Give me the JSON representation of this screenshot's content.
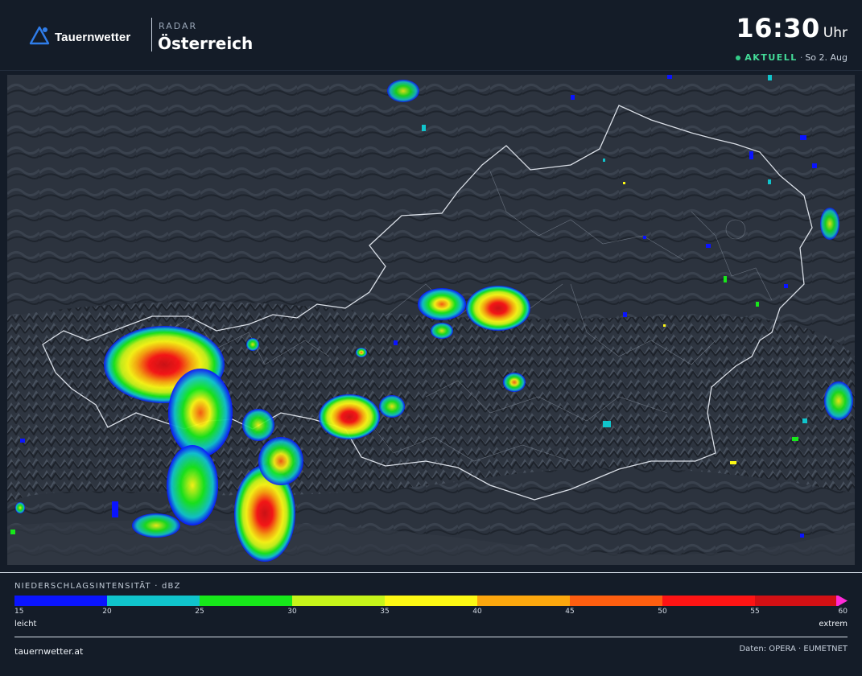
{
  "header": {
    "brand": "Tauernwetter",
    "kicker": "RADAR",
    "region": "Österreich",
    "time": "16:30",
    "time_unit": "Uhr",
    "status_live": "AKTUELL",
    "status_date": "So 2. Aug"
  },
  "legend": {
    "title": "NIEDERSCHLAGSINTENSITÄT · dBZ",
    "colors": [
      "#0a14ff",
      "#10c4cc",
      "#17e81a",
      "#c6f41a",
      "#fcf814",
      "#fca70e",
      "#fd5e10",
      "#fd1414",
      "#d21014"
    ],
    "end_arrow_color": "#ff2bd6",
    "ticks": [
      "15",
      "20",
      "25",
      "30",
      "35",
      "40",
      "45",
      "50",
      "55",
      "60"
    ],
    "low_label": "leicht",
    "high_label": "extrem"
  },
  "footer": {
    "site": "tauernwetter.at",
    "credits": "Daten: OPERA · EUMETNET"
  },
  "map": {
    "background": "#2a313c",
    "border_color": "#d9dee6"
  }
}
